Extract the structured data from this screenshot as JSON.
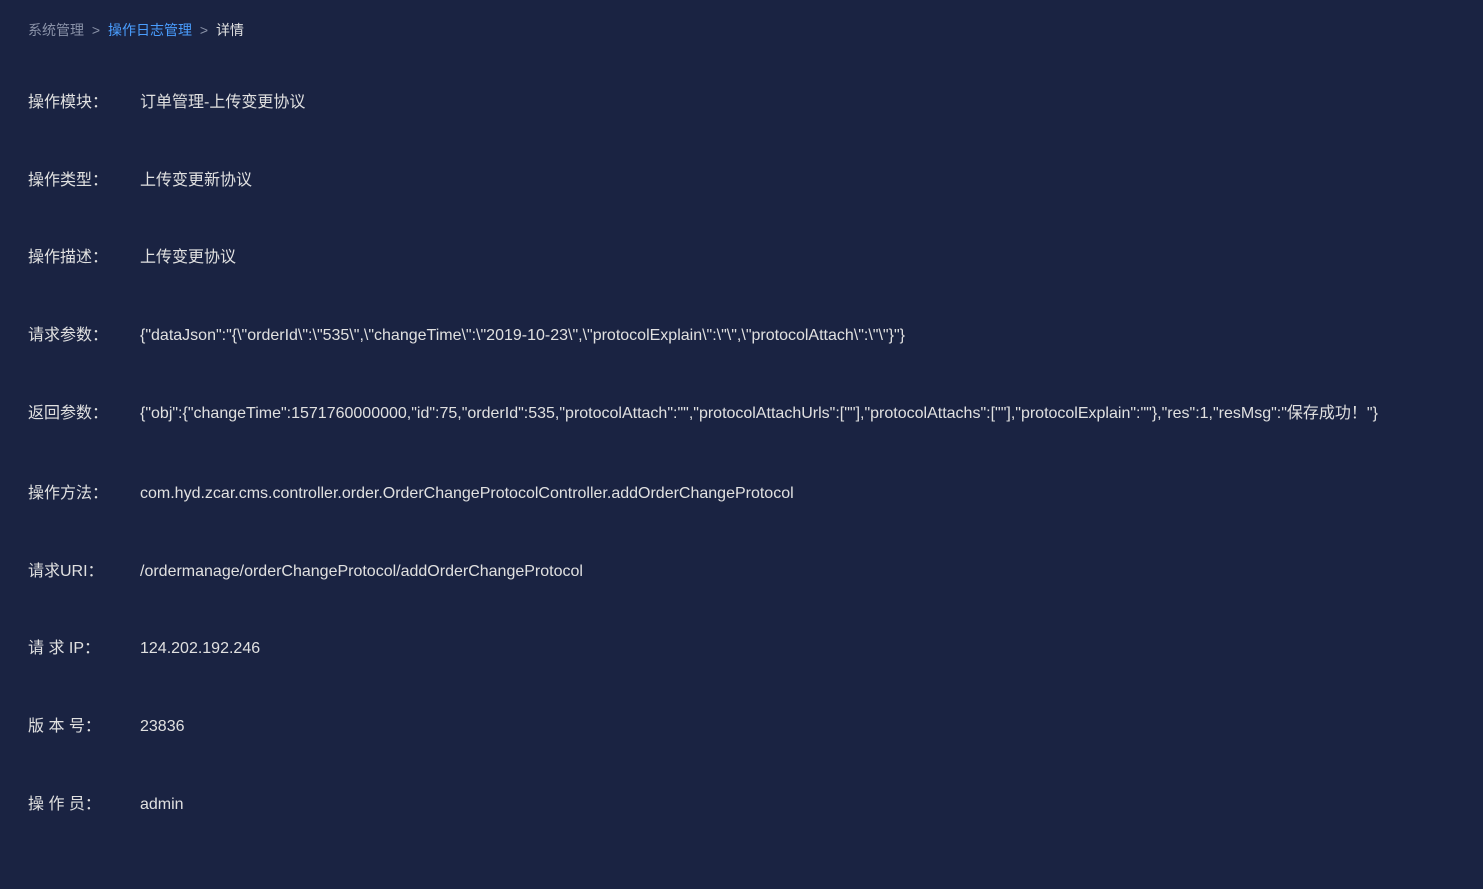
{
  "breadcrumb": {
    "item1": "系统管理",
    "item2": "操作日志管理",
    "item3": "详情",
    "sep": ">"
  },
  "labels": {
    "module": "操作模块：",
    "type": "操作类型：",
    "description": "操作描述：",
    "requestParams": "请求参数：",
    "responseParams": "返回参数：",
    "method": "操作方法：",
    "uri": "请求URI：",
    "ip": "请 求 IP：",
    "version": "版 本 号：",
    "operator": "操 作 员："
  },
  "values": {
    "module": "订单管理-上传变更协议",
    "type": "上传变更新协议",
    "description": "上传变更协议",
    "requestParams": "{\"dataJson\":\"{\\\"orderId\\\":\\\"535\\\",\\\"changeTime\\\":\\\"2019-10-23\\\",\\\"protocolExplain\\\":\\\"\\\",\\\"protocolAttach\\\":\\\"\\\"}\"}",
    "responseParams": "{\"obj\":{\"changeTime\":1571760000000,\"id\":75,\"orderId\":535,\"protocolAttach\":\"\",\"protocolAttachUrls\":[\"\"],\"protocolAttachs\":[\"\"],\"protocolExplain\":\"\"},\"res\":1,\"resMsg\":\"保存成功！\"}",
    "method": "com.hyd.zcar.cms.controller.order.OrderChangeProtocolController.addOrderChangeProtocol",
    "uri": "/ordermanage/orderChangeProtocol/addOrderChangeProtocol",
    "ip": "124.202.192.246",
    "version": "23836",
    "operator": "admin"
  }
}
